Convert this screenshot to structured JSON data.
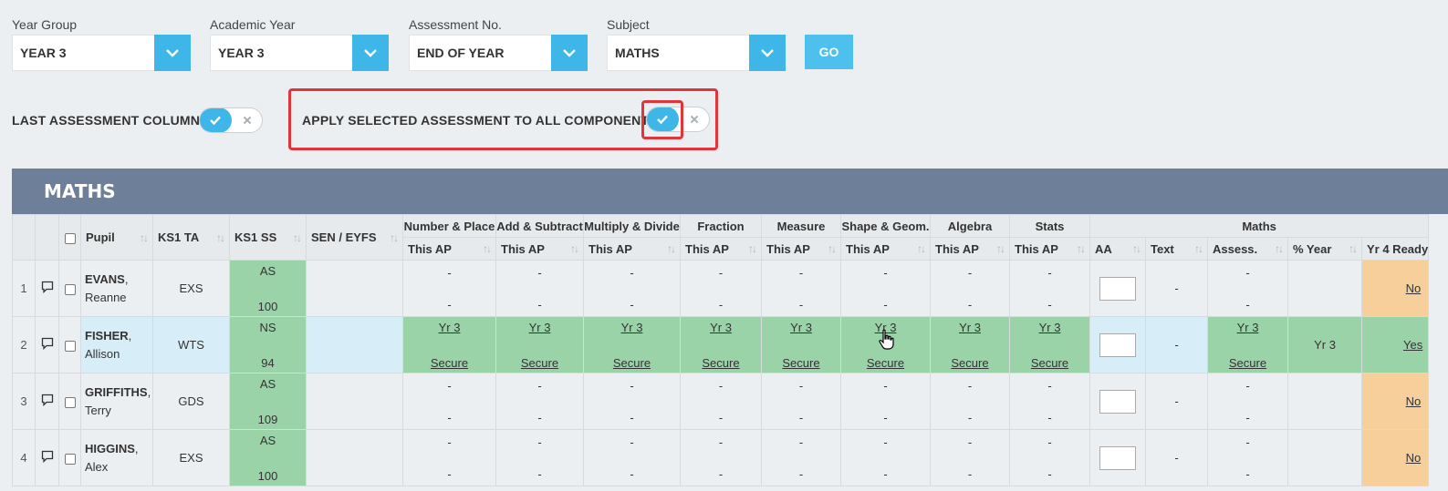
{
  "filters": [
    {
      "label": "Year Group",
      "value": "YEAR 3"
    },
    {
      "label": "Academic Year",
      "value": "YEAR 3"
    },
    {
      "label": "Assessment No.",
      "value": "END OF YEAR"
    },
    {
      "label": "Subject",
      "value": "MATHS"
    }
  ],
  "go_label": "GO",
  "toggles": {
    "last_assessment": "LAST ASSESSMENT COLUMN",
    "apply_selected": "APPLY SELECTED ASSESSMENT TO ALL COMPONENTS"
  },
  "panel_title": "MATHS",
  "table": {
    "headers": {
      "pupil": "Pupil",
      "ks1ta": "KS1 TA",
      "ks1ss": "KS1 SS",
      "sen": "SEN / EYFS",
      "groups": [
        "Number & Place",
        "Add & Subtract",
        "Multiply & Divide",
        "Fraction",
        "Measure",
        "Shape & Geom.",
        "Algebra",
        "Stats"
      ],
      "sub": "This AP",
      "maths_group": "Maths",
      "aa": "AA",
      "text": "Text",
      "assess": "Assess.",
      "pct_year": "% Year",
      "yr4ready": "Yr 4 Ready"
    },
    "rows": [
      {
        "n": "1",
        "last": "EVANS",
        "first": "Reanne",
        "ta": "EXS",
        "ss_top": "AS",
        "ss_bot": "100",
        "dash": "-",
        "assess_top": "-",
        "assess_bot": "-",
        "text": "-",
        "year": "",
        "ready": "No"
      },
      {
        "n": "2",
        "last": "FISHER",
        "first": "Allison",
        "ta": "WTS",
        "ss_top": "NS",
        "ss_bot": "94",
        "ap_top": "Yr 3",
        "ap_bot": "Secure",
        "text": "-",
        "assess_top": "Yr 3",
        "assess_bot": "Secure",
        "year": "Yr 3",
        "ready": "Yes"
      },
      {
        "n": "3",
        "last": "GRIFFITHS",
        "first": "Terry",
        "ta": "GDS",
        "ss_top": "AS",
        "ss_bot": "109",
        "dash": "-",
        "assess_top": "-",
        "assess_bot": "-",
        "text": "-",
        "year": "",
        "ready": "No"
      },
      {
        "n": "4",
        "last": "HIGGINS",
        "first": "Alex",
        "ta": "EXS",
        "ss_top": "AS",
        "ss_bot": "100",
        "dash": "-",
        "assess_top": "-",
        "assess_bot": "-",
        "text": "-",
        "year": "",
        "ready": "No"
      }
    ]
  },
  "colors": {
    "accent": "#3fb6e8",
    "green": "#9ad3a8",
    "orange": "#f6cf9a",
    "highlight": "#e0363b",
    "panel": "#6e7f9a"
  }
}
